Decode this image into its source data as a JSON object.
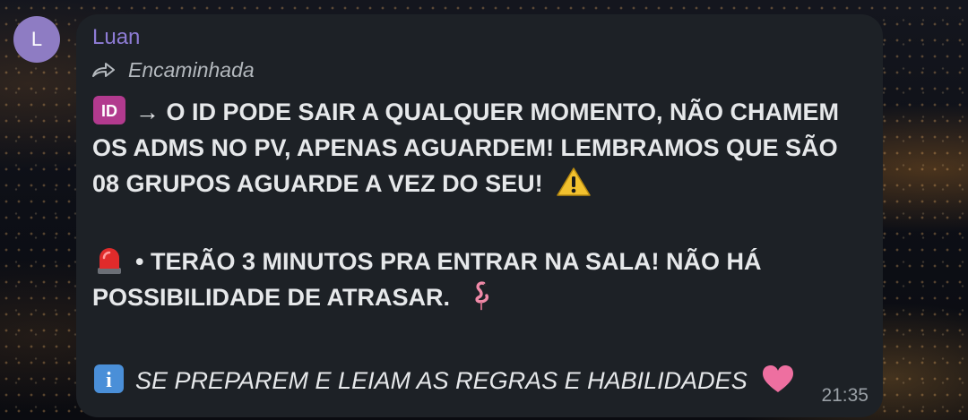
{
  "message": {
    "avatar_letter": "L",
    "sender": "Luan",
    "forwarded_label": "Encaminhada",
    "paragraphs": [
      "→ O ID PODE SAIR A QUALQUER MOMENTO, NÃO CHAMEM OS ADMS NO PV, APENAS AGUARDEM! LEMBRAMOS QUE SÃO 08 GRUPOS AGUARDE A VEZ DO SEU!",
      "• TERÃO 3 MINUTOS PRA ENTRAR NA SALA! NÃO HÁ POSSIBILIDADE DE ATRASAR.",
      "SE PREPAREM E LEIAM AS REGRAS E HABILIDADES"
    ],
    "emojis": {
      "id_badge": "ID",
      "warning": "warning-icon",
      "siren": "siren-icon",
      "flamingo": "flamingo-icon",
      "info": "i",
      "heart": "heart-icon"
    },
    "time": "21:35"
  },
  "colors": {
    "bubble": "#1d2126",
    "sender": "#8e7cd6",
    "avatar": "#8e7cc3",
    "text": "#e6e8ea",
    "meta": "#9aa0a6"
  }
}
